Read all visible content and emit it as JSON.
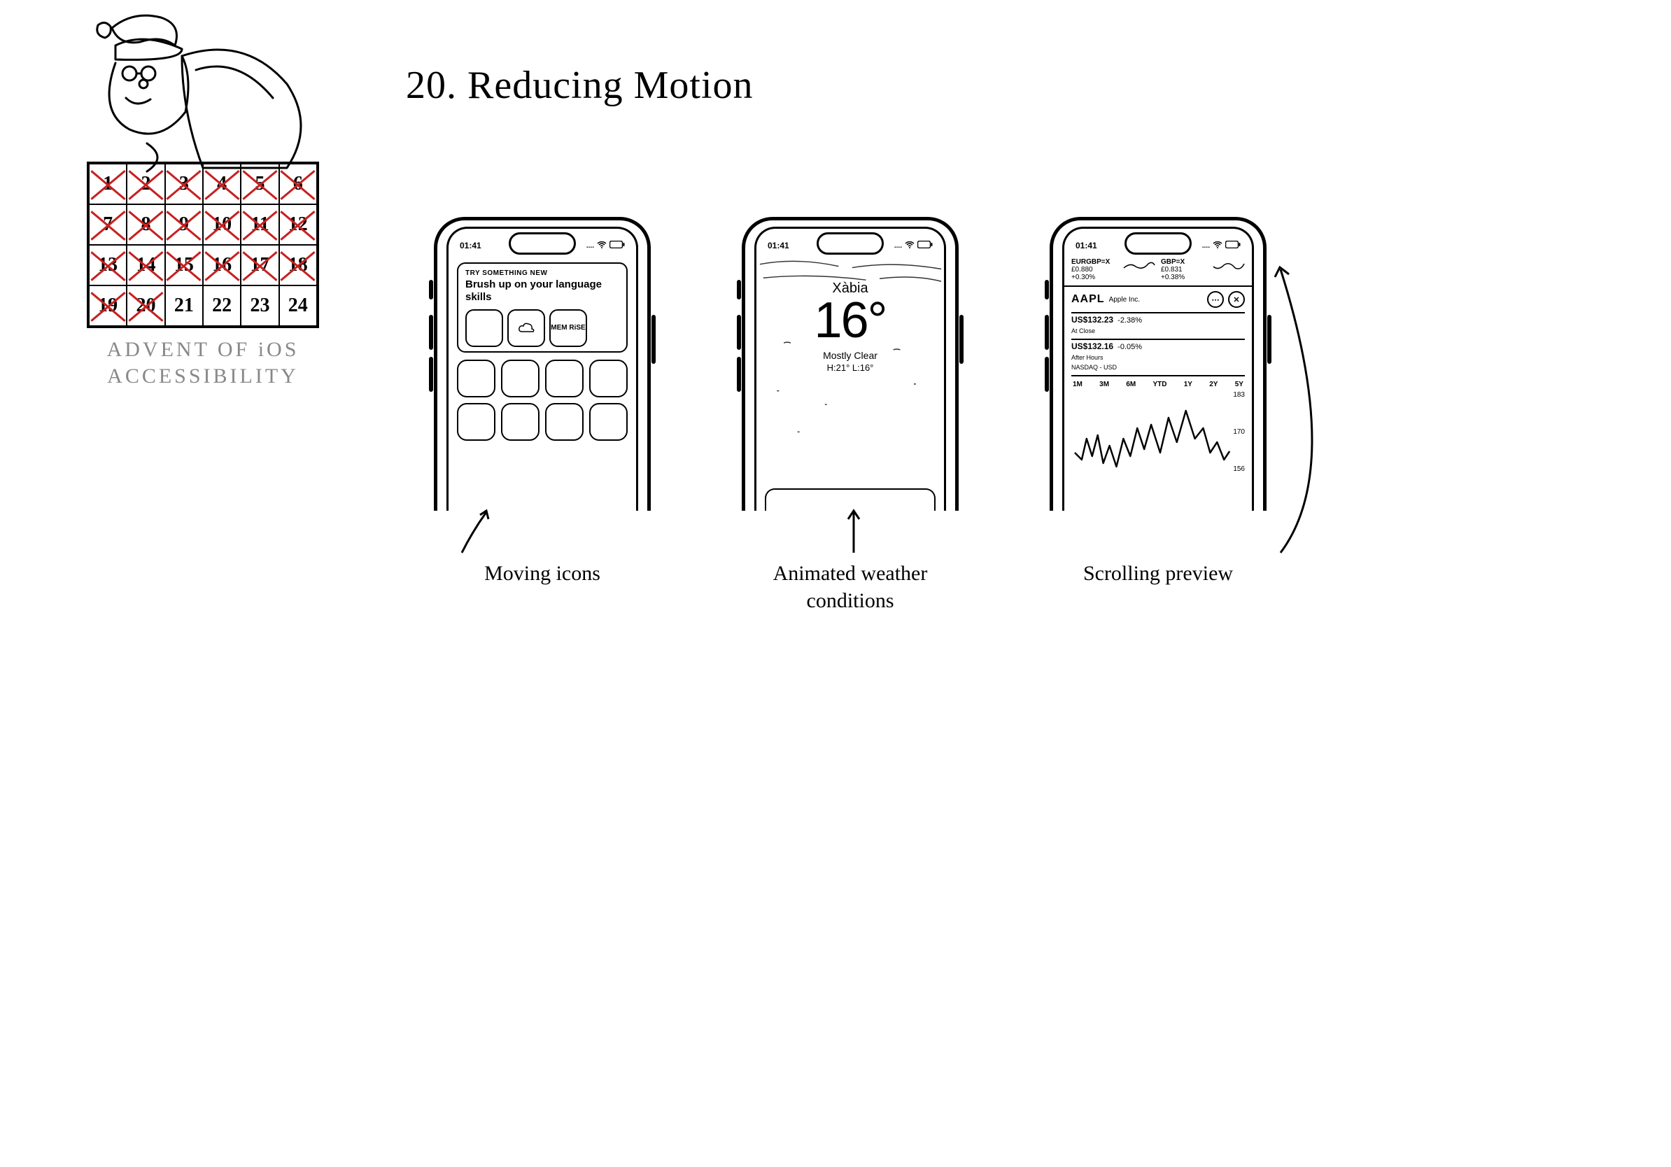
{
  "title": "20. Reducing Motion",
  "advent": {
    "label_line1": "ADVENT OF iOS",
    "label_line2": "ACCESSIBILITY",
    "days_total": 24,
    "crossed_through": 20
  },
  "status_time": "01:41",
  "phone1": {
    "tag": "TRY SOMETHING NEW",
    "headline": "Brush up on your language skills",
    "icon_mem": "MEM RiSE",
    "caption": "Moving icons"
  },
  "phone2": {
    "city": "Xàbia",
    "temp": "16°",
    "condition": "Mostly Clear",
    "high_low": "H:21° L:16°",
    "caption": "Animated weather conditions"
  },
  "phone3": {
    "tickers": [
      {
        "name": "EURGBP=X",
        "price": "£0.880",
        "chg": "+0.30%"
      },
      {
        "name": "GBP=X",
        "price": "£0.831",
        "chg": "+0.38%"
      }
    ],
    "symbol": "AAPL",
    "company": "Apple Inc.",
    "price1": "US$132.23",
    "price1_chg": "-2.38%",
    "price1_label": "At Close",
    "price2": "US$132.16",
    "price2_chg": "-0.05%",
    "price2_label": "After Hours",
    "exchange": "NASDAQ - USD",
    "ranges": [
      "1M",
      "3M",
      "6M",
      "YTD",
      "1Y",
      "2Y",
      "5Y"
    ],
    "y_values": [
      "183",
      "170",
      "156"
    ],
    "caption": "Scrolling preview"
  },
  "chart_data": {
    "type": "line",
    "title": "AAPL stock (sketch)",
    "xlabel": "",
    "ylabel": "US$",
    "ylim": [
      156,
      183
    ],
    "series": [
      {
        "name": "AAPL",
        "values": [
          160,
          158,
          165,
          162,
          170,
          166,
          175,
          168,
          178,
          172,
          180,
          170,
          165,
          160
        ]
      }
    ]
  }
}
